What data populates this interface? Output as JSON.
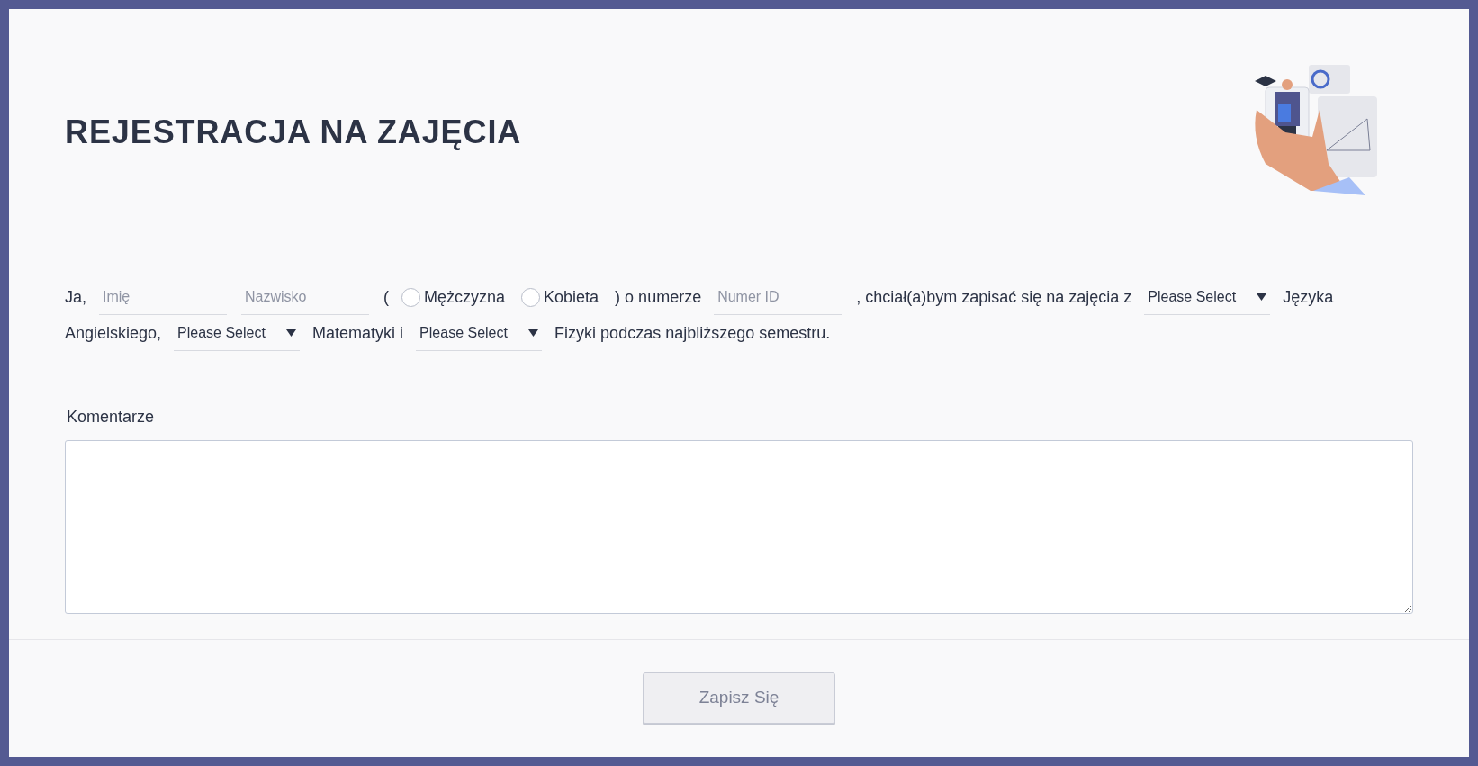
{
  "title": "REJESTRACJA NA ZAJĘCIA",
  "sentence": [
    {
      "kind": "text",
      "text": "Ja,"
    },
    {
      "kind": "input",
      "placeholder": "Imię"
    },
    {
      "kind": "input",
      "placeholder": "Nazwisko"
    },
    {
      "kind": "text",
      "text": "("
    },
    {
      "kind": "radio",
      "label": "Mężczyzna",
      "selected": false
    },
    {
      "kind": "radio",
      "label": "Kobieta",
      "selected": false
    },
    {
      "kind": "text",
      "text": ") o numerze"
    },
    {
      "kind": "input",
      "placeholder": "Numer ID"
    },
    {
      "kind": "text",
      "text": ", chciał(a)bym zapisać się na zajęcia z"
    },
    {
      "kind": "select",
      "value": "Please Select"
    },
    {
      "kind": "text",
      "text": "Języka"
    },
    {
      "kind": "text",
      "text": "Angielskiego,"
    },
    {
      "kind": "select",
      "value": "Please Select"
    },
    {
      "kind": "text",
      "text": "Matematyki i"
    },
    {
      "kind": "select",
      "value": "Please Select"
    },
    {
      "kind": "text",
      "text": "Fizyki podczas najbliższego semestru."
    }
  ],
  "comments": {
    "label": "Komentarze"
  },
  "submit": {
    "label": "Zapisz Się"
  }
}
